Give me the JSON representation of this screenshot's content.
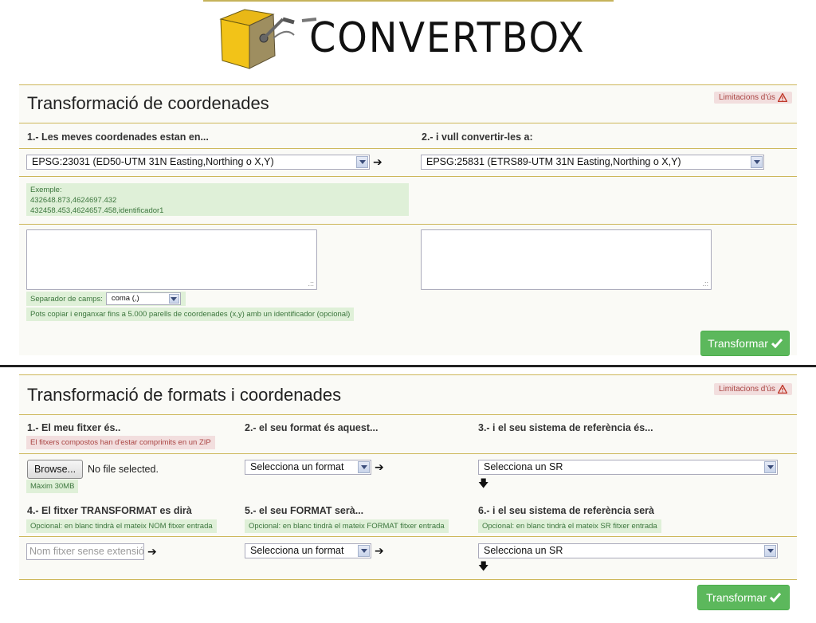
{
  "brand": {
    "name": "CONVERTBOX"
  },
  "coords": {
    "title": "Transformació de coordenades",
    "limit_label": "Limitacions d'ús",
    "step1": "1.- Les meves coordenades estan en...",
    "step2": "2.- i vull convertir-les a:",
    "src_srs": "EPSG:23031 (ED50-UTM 31N Easting,Northing o X,Y)",
    "dst_srs": "EPSG:25831 (ETRS89-UTM 31N Easting,Northing o X,Y)",
    "example_label": "Exemple:",
    "example_line1": "432648.873,4624697.432",
    "example_line2": "432458.453,4624657.458,identificador1",
    "separator_label": "Separador de camps:",
    "separator_value": "coma (,)",
    "paste_hint": "Pots copiar i enganxar fins a 5.000 parells de coordenades (x,y) amb un identificador (opcional)",
    "submit": "Transformar"
  },
  "formats": {
    "title": "Transformació de formats i coordenades",
    "limit_label": "Limitacions d'ús",
    "step1": "1.- El meu fitxer és..",
    "step1_note": "El fitxers compostos han d'estar comprimits en un ZIP",
    "step2": "2.- el seu format és aquest...",
    "step3": "3.- i el seu sistema de referència és...",
    "browse": "Browse...",
    "no_file": "No file selected.",
    "max_size": "Màxim 30MB",
    "format_select": "Selecciona un format",
    "sr_select": "Selecciona un SR",
    "step4": "4.- El fitxer TRANSFORMAT es dirà",
    "step5": "5.- el seu FORMAT serà...",
    "step6": "6.- i el seu sistema de referència serà",
    "note4": "Opcional: en blanc tindrà el mateix NOM fitxer entrada",
    "note5": "Opcional: en blanc tindrà el mateix FORMAT fitxer entrada",
    "note6": "Opcional: en blanc tindrà el mateix SR fitxer entrada",
    "out_name_placeholder": "Nom fitxer sense extensió",
    "out_format_select": "Selecciona un format",
    "out_sr_select": "Selecciona un SR",
    "submit": "Transformar"
  },
  "colors": {
    "accent": "#5cb85c",
    "gold": "#cdb75a",
    "logo_yellow": "#f2c318"
  }
}
